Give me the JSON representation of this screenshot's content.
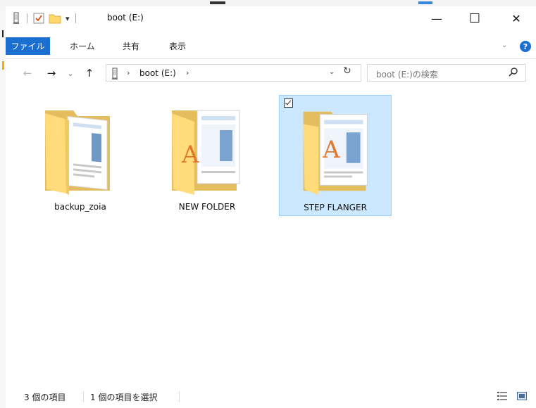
{
  "window": {
    "title": "boot (E:)",
    "minimize_glyph": "—",
    "maximize_glyph": "☐",
    "close_glyph": "✕",
    "quick_access_dropdown": "▾"
  },
  "ribbon": {
    "tabs": [
      {
        "label": "ファイル"
      },
      {
        "label": "ホーム"
      },
      {
        "label": "共有"
      },
      {
        "label": "表示"
      }
    ],
    "expand_glyph": "⌄",
    "help_glyph": "?"
  },
  "nav": {
    "back_glyph": "←",
    "forward_glyph": "→",
    "recent_glyph": "⌄",
    "up_glyph": "↑",
    "breadcrumb": "boot (E:)",
    "breadcrumb_sep": "›",
    "dropdown_glyph": "⌄",
    "refresh_glyph": "↻",
    "search_placeholder": "boot (E:)の検索"
  },
  "items": [
    {
      "name": "backup_zoia",
      "icon": "folder-icon",
      "selected": false
    },
    {
      "name": "NEW FOLDER",
      "icon": "folder-icon",
      "selected": false
    },
    {
      "name": "STEP FLANGER",
      "icon": "folder-icon",
      "selected": true
    }
  ],
  "status": {
    "item_count": "3 個の項目",
    "selected_count": "1 個の項目を選択"
  },
  "colors": {
    "accent": "#1a6fd1",
    "selection_bg": "#cce8ff",
    "selection_border": "#99d1ff",
    "folder_back": "#e8c76a",
    "folder_front": "#ffe08a"
  }
}
